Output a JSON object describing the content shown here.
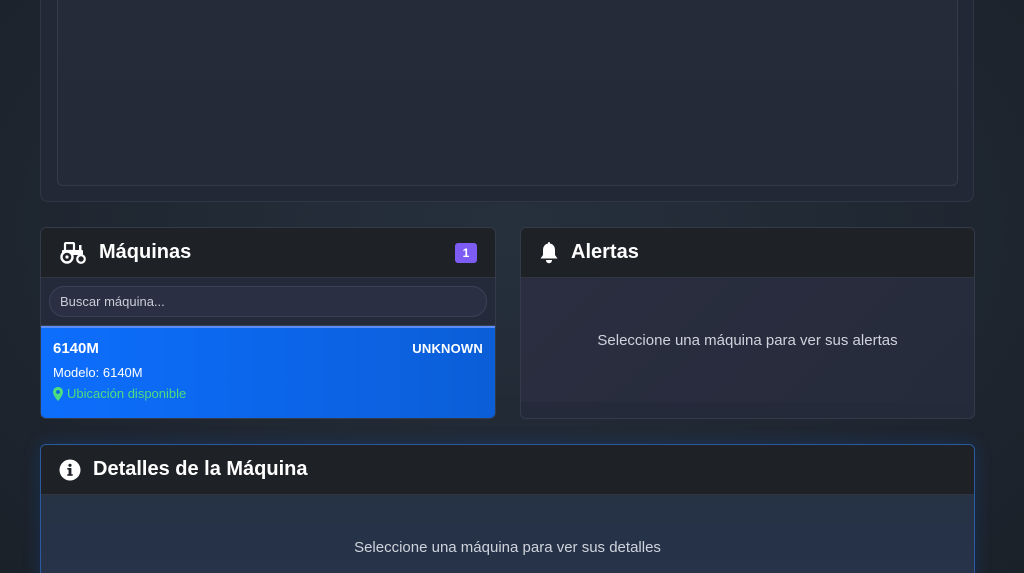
{
  "machines_card": {
    "title": "Máquinas",
    "count_badge": "1",
    "search": {
      "placeholder": "Buscar máquina...",
      "value": ""
    },
    "items": [
      {
        "name": "6140M",
        "status": "UNKNOWN",
        "model_text": "Modelo: 6140M",
        "location_text": "Ubicación disponible"
      }
    ]
  },
  "alerts_card": {
    "title": "Alertas",
    "empty_message": "Seleccione una máquina para ver sus alertas"
  },
  "details_card": {
    "title": "Detalles de la Máquina",
    "empty_message": "Seleccione una máquina para ver sus detalles"
  },
  "icons": {
    "machines": "tractor-icon",
    "alerts": "bell-icon",
    "details": "info-icon",
    "location": "map-marker-icon"
  },
  "colors": {
    "accent_blue": "#0d6efd",
    "badge_purple": "#7c5cf2",
    "location_green": "#4ade80",
    "header_bg": "#1e2126"
  }
}
